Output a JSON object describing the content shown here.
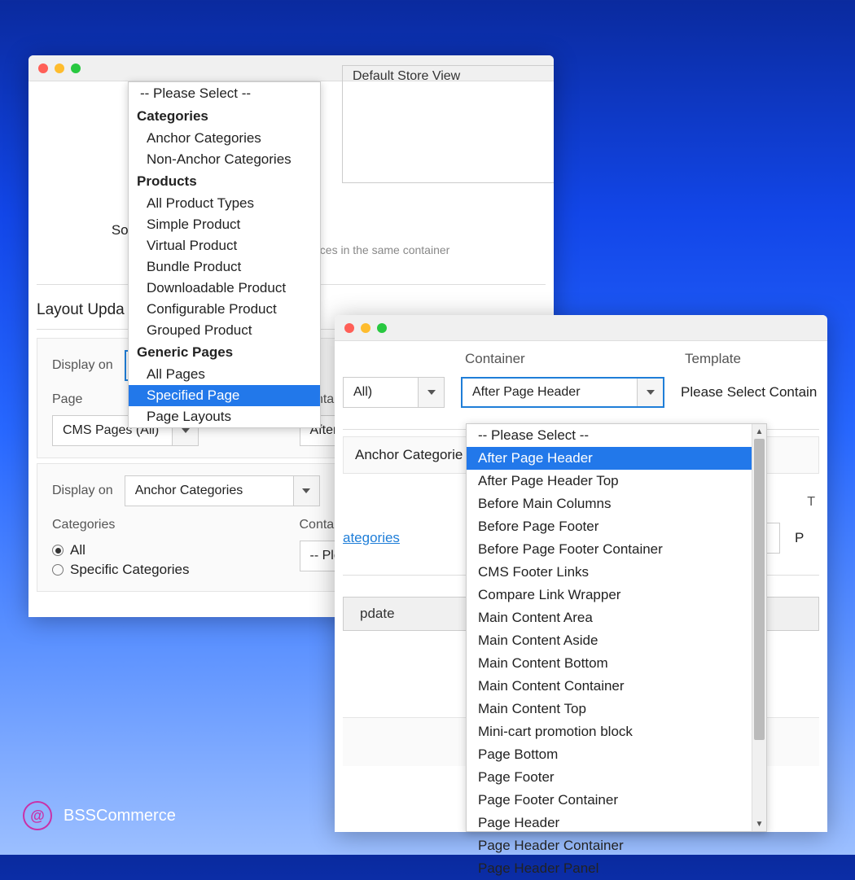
{
  "win1": {
    "store_view": "Default Store View",
    "sort_label": "Sort",
    "sort_help": "nces in the same container",
    "layout_updates_title": "Layout Upda",
    "display_on_label": "Display on",
    "display_on_value": "Specified Page",
    "page_label": "Page",
    "page_value": "CMS Pages (All)",
    "container_label": "Container",
    "container_value": "After Page Head",
    "display_on_2_value": "Anchor Categories",
    "categories_label": "Categories",
    "radio_all": "All",
    "radio_specific": "Specific Categories",
    "container2_value": "-- Please Select -"
  },
  "dd1": {
    "please_select": "-- Please Select --",
    "g1": "Categories",
    "g1_items": [
      "Anchor Categories",
      "Non-Anchor Categories"
    ],
    "g2": "Products",
    "g2_items": [
      "All Product Types",
      "Simple Product",
      "Virtual Product",
      "Bundle Product",
      "Downloadable Product",
      "Configurable Product",
      "Grouped Product"
    ],
    "g3": "Generic Pages",
    "g3_items": [
      "All Pages",
      "Specified Page",
      "Page Layouts"
    ]
  },
  "win2": {
    "container_label": "Container",
    "template_label": "Template",
    "all_value": "All)",
    "container_value": "After Page Header",
    "template_value": "Please Select Contain",
    "anchor_categories": "Anchor Categorie",
    "categories_link": "ategories",
    "t_label": "T",
    "p_value": "P",
    "update_btn": "pdate"
  },
  "dd2": {
    "items": [
      "-- Please Select --",
      "After Page Header",
      "After Page Header Top",
      "Before Main Columns",
      "Before Page Footer",
      "Before Page Footer Container",
      "CMS Footer Links",
      "Compare Link Wrapper",
      "Main Content Area",
      "Main Content Aside",
      "Main Content Bottom",
      "Main Content Container",
      "Main Content Top",
      "Mini-cart promotion block",
      "Page Bottom",
      "Page Footer",
      "Page Footer Container",
      "Page Header",
      "Page Header Container",
      "Page Header Panel"
    ]
  },
  "logo": "BSSCommerce"
}
